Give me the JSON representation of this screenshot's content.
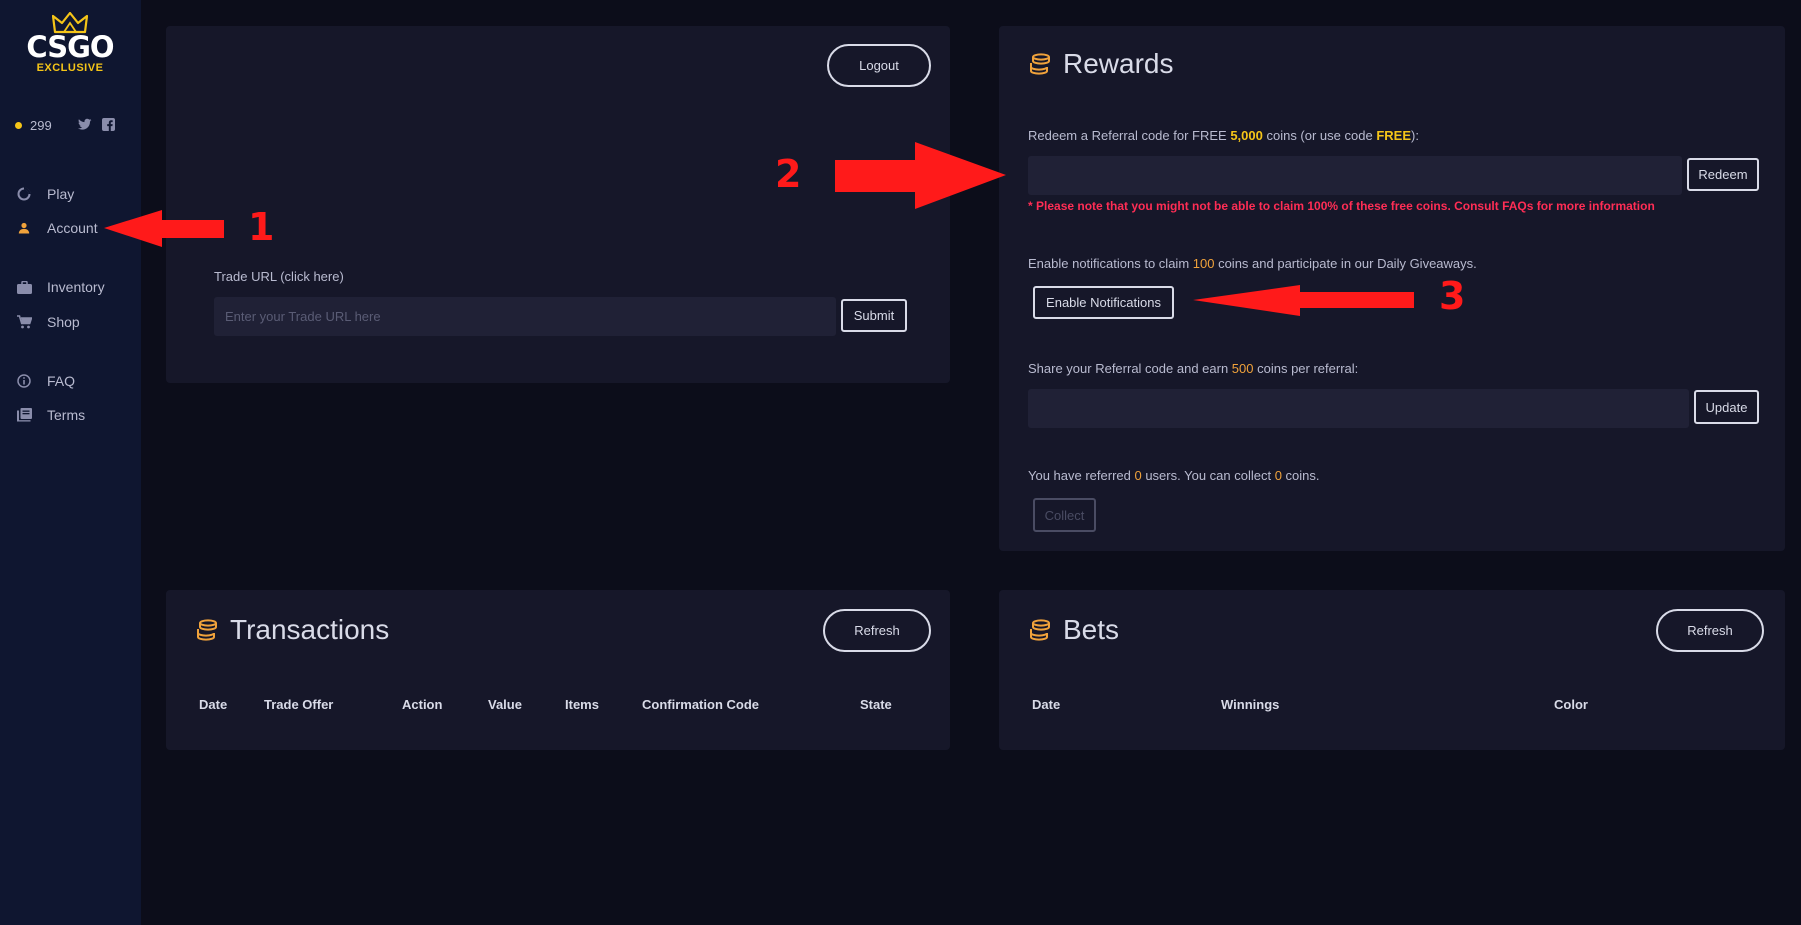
{
  "brand": {
    "name": "CSGO",
    "tagline": "EXCLUSIVE",
    "accent": "#f5c518"
  },
  "balance": {
    "coins": "299"
  },
  "social": [
    "twitter-icon",
    "facebook-icon"
  ],
  "nav": [
    {
      "label": "Play",
      "icon": "play-icon"
    },
    {
      "label": "Account",
      "icon": "user-icon"
    },
    {
      "label": "Inventory",
      "icon": "briefcase-icon"
    },
    {
      "label": "Shop",
      "icon": "cart-icon"
    },
    {
      "label": "FAQ",
      "icon": "info-icon"
    },
    {
      "label": "Terms",
      "icon": "book-icon"
    }
  ],
  "account": {
    "logout": "Logout",
    "trade_url_label": "Trade URL (click here)",
    "trade_url_placeholder": "Enter your Trade URL here",
    "trade_url_value": "",
    "submit": "Submit"
  },
  "rewards": {
    "title": "Rewards",
    "redeem_text": {
      "p1": "Redeem a Referral code for FREE ",
      "amount": "5,000",
      "p2": " coins (or use code ",
      "code": "FREE",
      "p3": "):"
    },
    "redeem_value": "",
    "redeem_button": "Redeem",
    "warning": "* Please note that you might not be able to claim 100% of these free coins. Consult FAQs for more information",
    "notify_text": {
      "p1": "Enable notifications to claim ",
      "amount": "100",
      "p2": " coins and participate in our Daily Giveaways."
    },
    "notify_button": "Enable Notifications",
    "share_text": {
      "p1": "Share your Referral code and earn ",
      "amount": "500",
      "p2": " coins per referral:"
    },
    "share_value": "",
    "update_button": "Update",
    "referred_text": {
      "p1": "You have referred ",
      "users": "0",
      "p2": " users. You can collect ",
      "coins": "0",
      "p3": " coins."
    },
    "collect_button": "Collect"
  },
  "transactions": {
    "title": "Transactions",
    "refresh": "Refresh",
    "columns": [
      "Date",
      "Trade Offer",
      "Action",
      "Value",
      "Items",
      "Confirmation Code",
      "State"
    ]
  },
  "bets": {
    "title": "Bets",
    "refresh": "Refresh",
    "columns": [
      "Date",
      "Winnings",
      "Color"
    ]
  },
  "annotations": [
    "1",
    "2",
    "3"
  ],
  "colors": {
    "annotation": "#ff1a1a",
    "highlight": "#f0a23b",
    "warning": "#ff2d55"
  }
}
